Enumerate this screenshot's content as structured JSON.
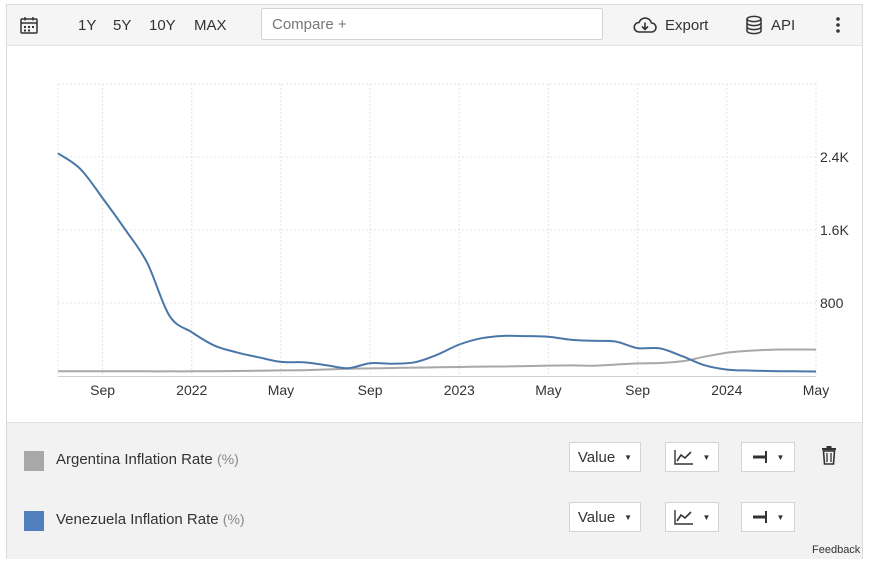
{
  "toolbar": {
    "ranges": [
      "1Y",
      "5Y",
      "10Y",
      "MAX"
    ],
    "compare_placeholder": "Compare +",
    "export_label": "Export",
    "api_label": "API"
  },
  "chart_data": {
    "type": "line",
    "x": [
      "2021-07",
      "2021-08",
      "2021-09",
      "2021-10",
      "2021-11",
      "2021-12",
      "2022-01",
      "2022-02",
      "2022-03",
      "2022-04",
      "2022-05",
      "2022-06",
      "2022-07",
      "2022-08",
      "2022-09",
      "2022-10",
      "2022-11",
      "2022-12",
      "2023-01",
      "2023-02",
      "2023-03",
      "2023-04",
      "2023-05",
      "2023-06",
      "2023-07",
      "2023-08",
      "2023-09",
      "2023-10",
      "2023-11",
      "2023-12",
      "2024-01",
      "2024-02",
      "2024-03",
      "2024-04",
      "2024-05"
    ],
    "x_tick_labels": [
      "Sep",
      "2022",
      "May",
      "Sep",
      "2023",
      "May",
      "Sep",
      "2024",
      "May"
    ],
    "y_tick_labels": [
      "800",
      "1.6K",
      "2.4K"
    ],
    "ylim": [
      0,
      3200
    ],
    "grid": true,
    "series": [
      {
        "name": "Argentina Inflation Rate",
        "color": "#a8a8a8",
        "values": [
          52,
          51,
          52,
          52,
          51,
          51,
          51,
          52,
          55,
          58,
          61,
          64,
          71,
          79,
          83,
          88,
          92,
          95,
          99,
          103,
          104,
          109,
          114,
          116,
          113,
          125,
          138,
          143,
          161,
          211,
          255,
          276,
          288,
          290,
          289
        ]
      },
      {
        "name": "Venezuela Inflation Rate",
        "color": "#4a77aa",
        "values": [
          2440,
          2270,
          1950,
          1610,
          1240,
          660,
          480,
          335,
          260,
          205,
          155,
          150,
          120,
          85,
          140,
          135,
          150,
          232,
          345,
          414,
          439,
          437,
          431,
          398,
          386,
          378,
          306,
          303,
          217,
          118,
          70,
          60,
          54,
          51,
          49
        ]
      }
    ]
  },
  "legend": {
    "rows": [
      {
        "label": "Argentina Inflation Rate",
        "unit": "(%)",
        "color": "#a8a8a8",
        "value_label": "Value"
      },
      {
        "label": "Venezuela Inflation Rate",
        "unit": "(%)",
        "color": "#4f7fbe",
        "value_label": "Value"
      }
    ]
  },
  "feedback_label": "Feedback"
}
